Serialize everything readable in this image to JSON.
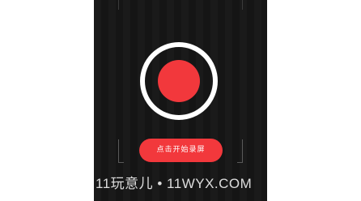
{
  "colors": {
    "accent": "#f2383c",
    "background": "#151515",
    "ring": "#ffffff"
  },
  "recorder": {
    "record_icon": "record-icon",
    "start_label": "点击开始录屏"
  },
  "watermark": {
    "text": "11玩意儿 • 11WYX.COM"
  }
}
